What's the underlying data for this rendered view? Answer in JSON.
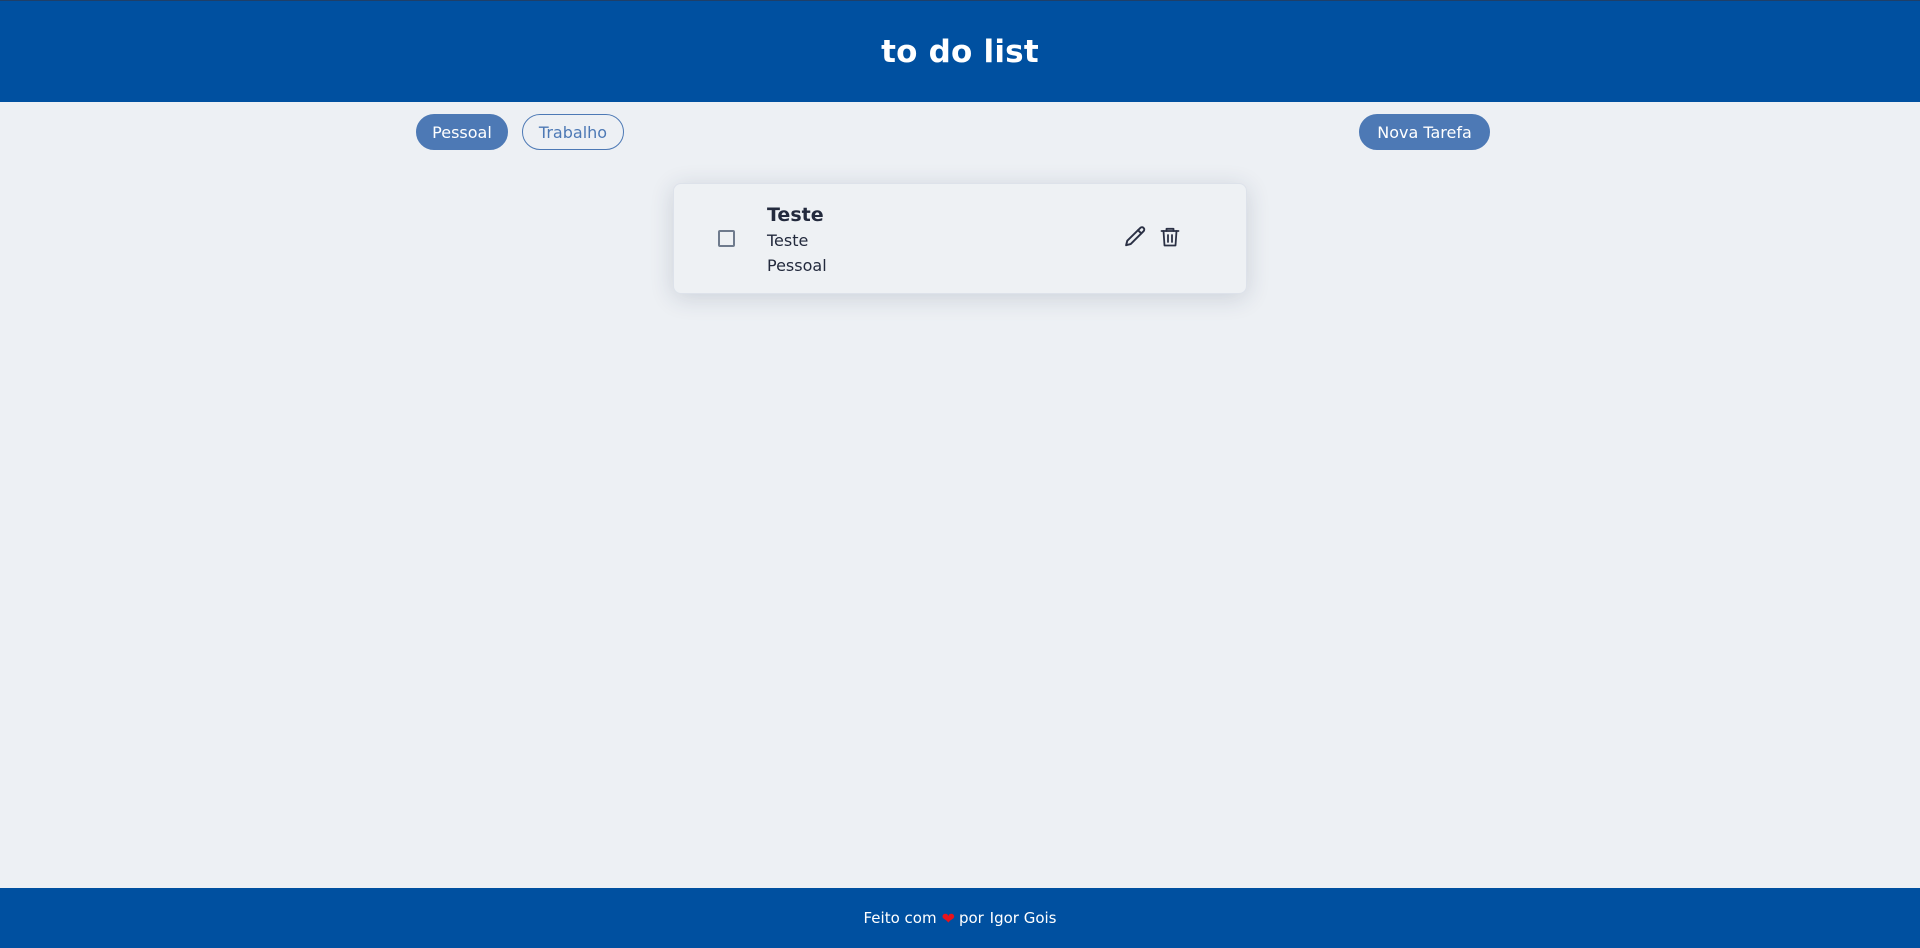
{
  "header": {
    "title": "to do list"
  },
  "toolbar": {
    "tabs": [
      {
        "label": "Pessoal",
        "active": true
      },
      {
        "label": "Trabalho",
        "active": false
      }
    ],
    "new_task_label": "Nova Tarefa"
  },
  "tasks": [
    {
      "title": "Teste",
      "description": "Teste",
      "category": "Pessoal",
      "done": false,
      "actions": [
        "pencil-icon",
        "trash-icon"
      ]
    }
  ],
  "footer": {
    "prefix": "Feito com",
    "heart": "❤",
    "middle": "por",
    "author": "Igor Gois"
  },
  "colors": {
    "primary": "#0050a0",
    "accent": "#4d79b5",
    "background": "#edf0f4",
    "text": "#232a3d",
    "heart": "#e8131b"
  }
}
